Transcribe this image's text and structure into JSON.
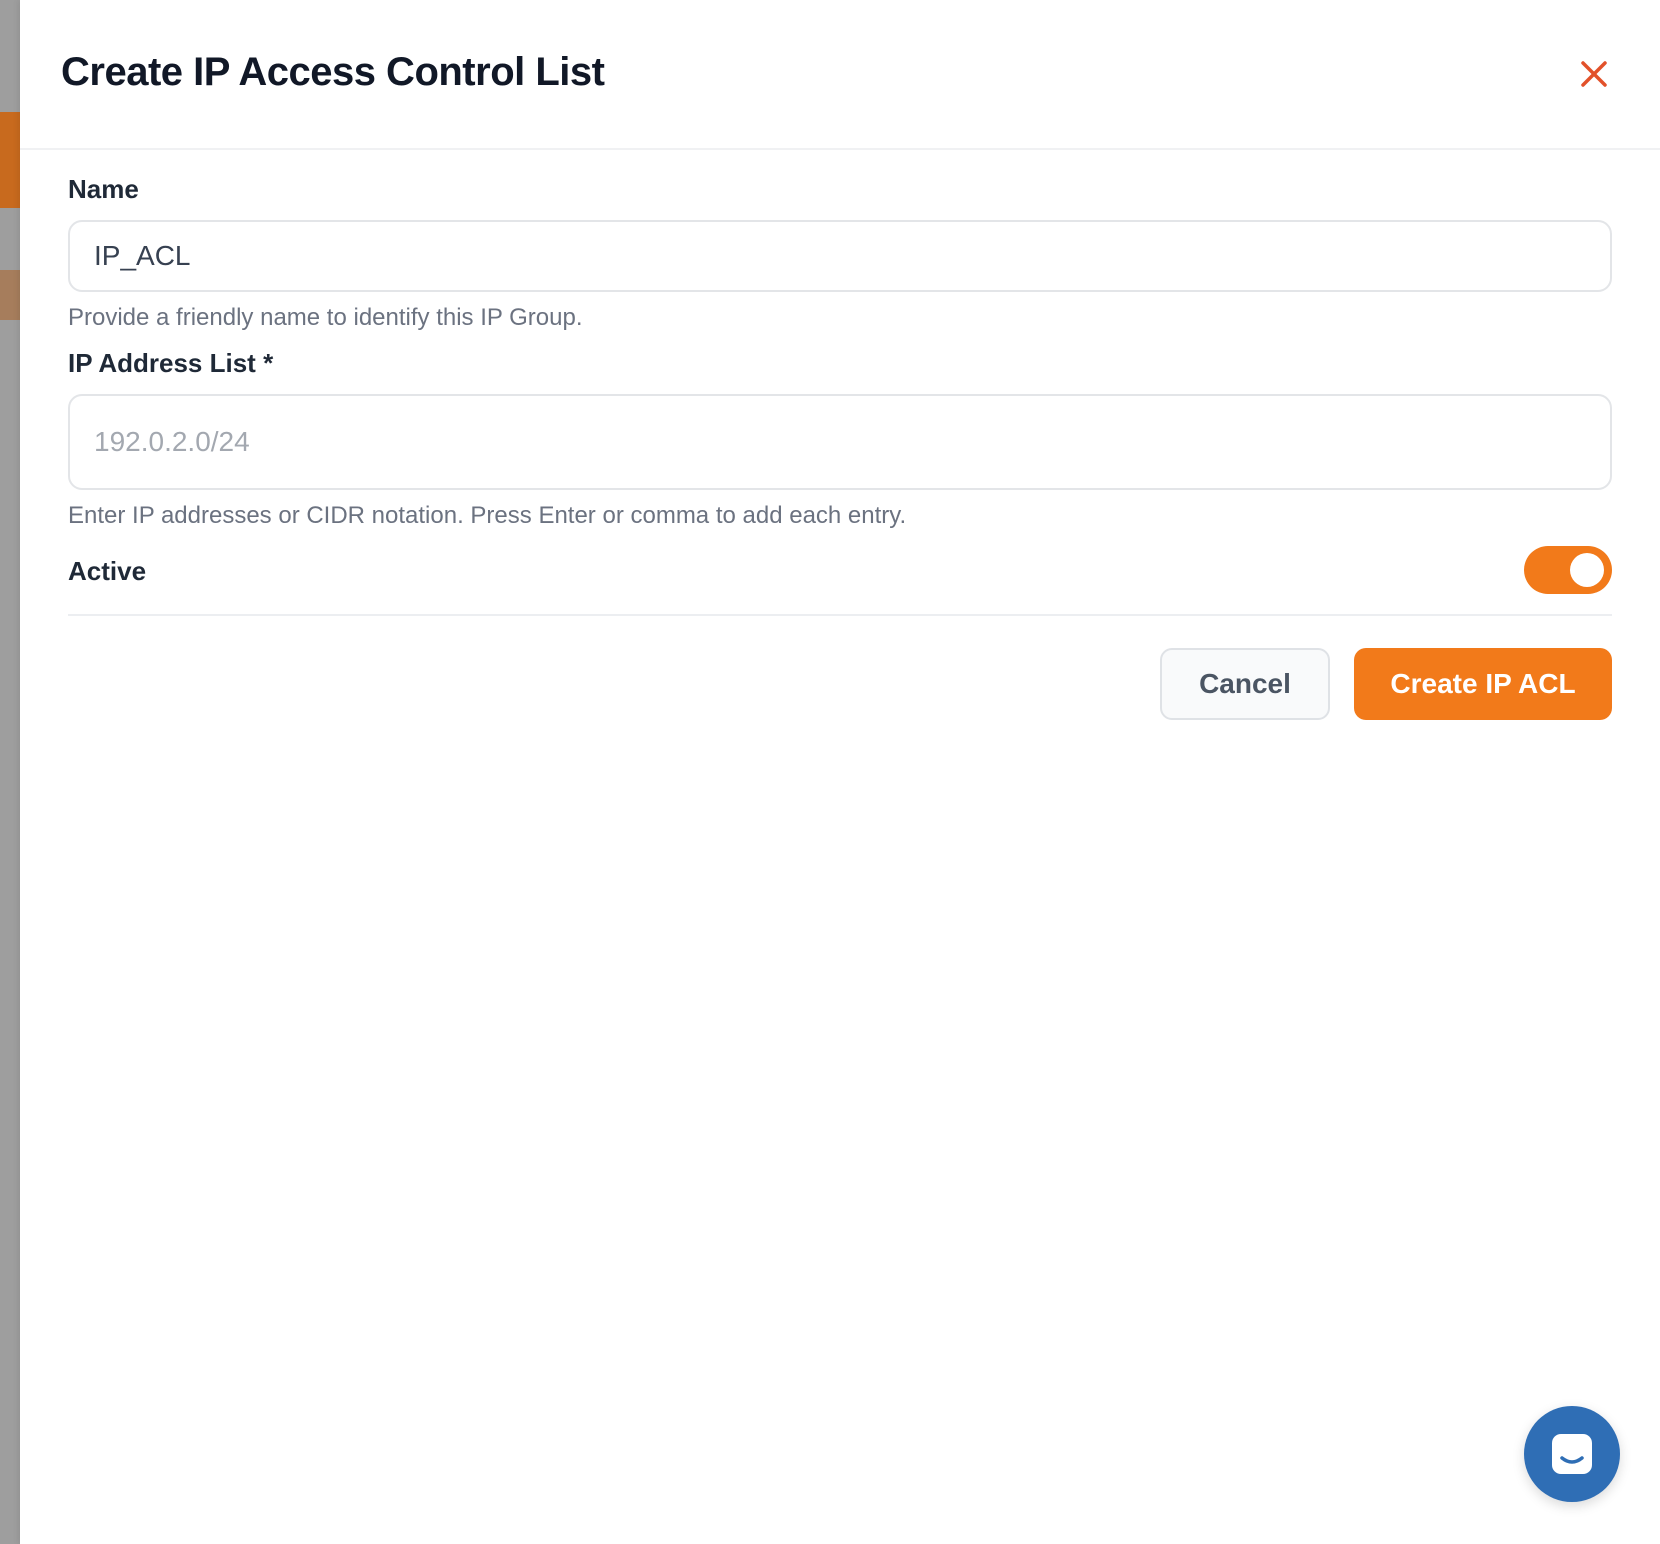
{
  "dialog": {
    "title": "Create IP Access Control List",
    "close_icon": "close-icon"
  },
  "form": {
    "name": {
      "label": "Name",
      "value": "IP_ACL",
      "help": "Provide a friendly name to identify this IP Group."
    },
    "ip_list": {
      "label": "IP Address List *",
      "placeholder": "192.0.2.0/24",
      "help": "Enter IP addresses or CIDR notation. Press Enter or comma to add each entry."
    },
    "active": {
      "label": "Active",
      "enabled": true
    }
  },
  "actions": {
    "cancel_label": "Cancel",
    "create_label": "Create IP ACL"
  },
  "chat": {
    "icon": "chat-icon"
  },
  "colors": {
    "accent": "#f27a1a",
    "close": "#e2512a",
    "chat": "#2f6eb5"
  }
}
